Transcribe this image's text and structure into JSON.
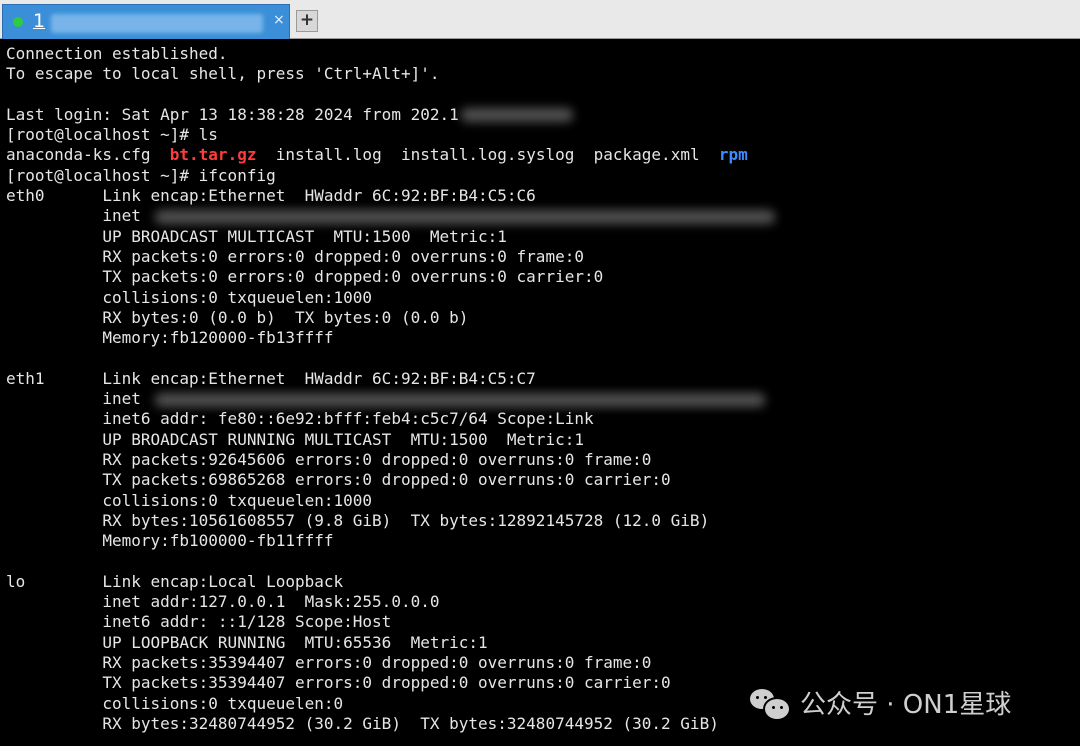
{
  "tab": {
    "number": "1",
    "close_glyph": "×",
    "status_color": "#2ecc40"
  },
  "new_tab_glyph": "+",
  "terminal": {
    "conn1": "Connection established.",
    "conn2": "To escape to local shell, press 'Ctrl+Alt+]'.",
    "last_login": "Last login: Sat Apr 13 18:38:28 2024 from 202.1",
    "prompt1": "[root@localhost ~]# ls",
    "ls_files": [
      {
        "name": "anaconda-ks.cfg",
        "color": "#e6e6e6"
      },
      {
        "name": "bt.tar.gz",
        "color": "#ff3b3b"
      },
      {
        "name": "install.log",
        "color": "#e6e6e6"
      },
      {
        "name": "install.log.syslog",
        "color": "#e6e6e6"
      },
      {
        "name": "package.xml",
        "color": "#e6e6e6"
      },
      {
        "name": "rpm",
        "color": "#3d8cff"
      }
    ],
    "prompt2": "[root@localhost ~]# ifconfig",
    "eth0": [
      "eth0      Link encap:Ethernet  HWaddr 6C:92:BF:B4:C5:C6",
      "          inet",
      "          UP BROADCAST MULTICAST  MTU:1500  Metric:1",
      "          RX packets:0 errors:0 dropped:0 overruns:0 frame:0",
      "          TX packets:0 errors:0 dropped:0 overruns:0 carrier:0",
      "          collisions:0 txqueuelen:1000",
      "          RX bytes:0 (0.0 b)  TX bytes:0 (0.0 b)",
      "          Memory:fb120000-fb13ffff"
    ],
    "eth1": [
      "eth1      Link encap:Ethernet  HWaddr 6C:92:BF:B4:C5:C7",
      "          inet",
      "          inet6 addr: fe80::6e92:bfff:feb4:c5c7/64 Scope:Link",
      "          UP BROADCAST RUNNING MULTICAST  MTU:1500  Metric:1",
      "          RX packets:92645606 errors:0 dropped:0 overruns:0 frame:0",
      "          TX packets:69865268 errors:0 dropped:0 overruns:0 carrier:0",
      "          collisions:0 txqueuelen:1000",
      "          RX bytes:10561608557 (9.8 GiB)  TX bytes:12892145728 (12.0 GiB)",
      "          Memory:fb100000-fb11ffff"
    ],
    "lo": [
      "lo        Link encap:Local Loopback",
      "          inet addr:127.0.0.1  Mask:255.0.0.0",
      "          inet6 addr: ::1/128 Scope:Host",
      "          UP LOOPBACK RUNNING  MTU:65536  Metric:1",
      "          RX packets:35394407 errors:0 dropped:0 overruns:0 frame:0",
      "          TX packets:35394407 errors:0 dropped:0 overruns:0 carrier:0",
      "          collisions:0 txqueuelen:0",
      "          RX bytes:32480744952 (30.2 GiB)  TX bytes:32480744952 (30.2 GiB)"
    ]
  },
  "watermark": {
    "text": "公众号 · ON1星球",
    "icon": "wechat-icon"
  }
}
